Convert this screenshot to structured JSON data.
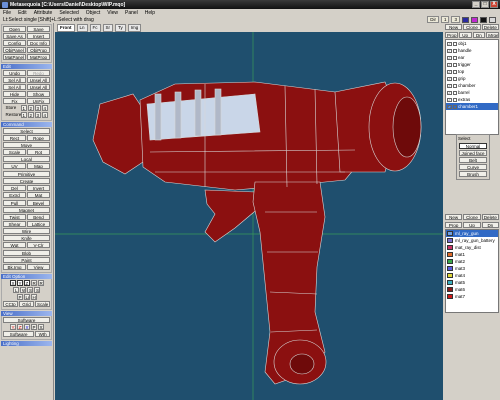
{
  "window": {
    "title": "Metasequoia [C:\\Users\\Daniel\\Desktop\\WIP.mqo]",
    "min": "_",
    "max": "□",
    "close": "X"
  },
  "menu": [
    "File",
    "Edit",
    "Attribute",
    "Selected",
    "Object",
    "View",
    "Panel",
    "Help"
  ],
  "status": {
    "text": "Lt:Select single  [Shift]+L:Select with drag",
    "right_buttons": [
      "Dir",
      "1",
      "3"
    ],
    "palette_colors": [
      "#2a2aa0",
      "#c02ad0",
      "#111111",
      "#d8d8d8"
    ]
  },
  "left_panel": {
    "file": {
      "rows": [
        [
          "Open",
          "Save"
        ],
        [
          "Save As",
          "Insert"
        ],
        [
          "Config",
          "Doc Info"
        ],
        [
          "ObjPanel",
          "ObjProp"
        ],
        [
          "MatPanel",
          "MatProp"
        ]
      ]
    },
    "edit": {
      "title": "Edit",
      "rows": [
        [
          "Undo",
          "Redo"
        ],
        [
          "Sel All",
          "Unsel All"
        ],
        [
          "Sel All",
          "Unsel All"
        ],
        [
          "Hide",
          "Show"
        ],
        [
          "Fix",
          "UnFix"
        ]
      ],
      "store": "Store",
      "restore": "Restore",
      "slots": [
        "1",
        "2",
        "3",
        "4"
      ]
    },
    "command": {
      "title": "Command",
      "items": [
        [
          "Select"
        ],
        [
          "Rect",
          "Rope"
        ],
        [
          "Move"
        ],
        [
          "Scale",
          "Rot"
        ],
        [
          "Local"
        ],
        [
          "UV",
          "Map"
        ],
        [
          "Primitive"
        ],
        [
          "Create"
        ],
        [
          "Del",
          "Invert"
        ],
        [
          "Extrd",
          "Mat"
        ],
        [
          "Pull",
          "Bevel"
        ],
        [
          "Magnet"
        ],
        [
          "Twist",
          "Bend"
        ],
        [
          "Shear",
          "Lattice"
        ],
        [
          "Wire"
        ],
        [
          "Knife"
        ],
        [
          "Wgt",
          "V-Clr"
        ],
        [
          "Blob"
        ],
        [
          "Paint"
        ],
        [
          "Bk.Img",
          "View"
        ]
      ]
    },
    "edit_option": {
      "title": "Edit Option",
      "row1": [
        "X",
        "Y",
        "Z",
        "Rc",
        "Rp"
      ],
      "row2": [
        "L",
        "W",
        "S",
        "Sy"
      ],
      "row3": [
        "P",
        "Ln",
        "Hi"
      ],
      "row4": [
        "CCtp",
        "Grid",
        "Scale"
      ]
    },
    "view": {
      "title": "View",
      "software": "Software",
      "axis": [
        "YZ",
        "ZX",
        "XY",
        "P",
        "Xz"
      ],
      "bottom": [
        "Software",
        "Wth"
      ]
    },
    "lighting": {
      "title": "Lighting"
    }
  },
  "viewport": {
    "tabs": [
      "Front",
      "Ln",
      "Fc",
      "Sr",
      "Ty",
      "Img"
    ],
    "active_tab": "Front",
    "background": "#1f4f6e",
    "model": "ray-gun"
  },
  "right_panel": {
    "object_buttons": [
      "New",
      "Clone",
      "Delete"
    ],
    "object_tabs": [
      "Prop",
      "Up",
      "Dn",
      "Mrge"
    ],
    "objects": [
      {
        "name": "obj1",
        "selected": false
      },
      {
        "name": "handle",
        "selected": false
      },
      {
        "name": "ear",
        "selected": false
      },
      {
        "name": "trigger",
        "selected": false
      },
      {
        "name": "top",
        "selected": false
      },
      {
        "name": "grip",
        "selected": false
      },
      {
        "name": "chamber",
        "selected": false
      },
      {
        "name": "barrel",
        "selected": false
      },
      {
        "name": "extras",
        "selected": false
      },
      {
        "name": "chamber1",
        "selected": true
      }
    ],
    "select_box": {
      "title": "Select",
      "buttons": [
        "Normal",
        "Joined face",
        "Belt",
        "Curve",
        "Brush"
      ]
    },
    "material_buttons": [
      "New",
      "Clone",
      "Delete"
    ],
    "material_tabs": [
      "Prop",
      "Up",
      "Dn"
    ],
    "materials": [
      {
        "name": "ml_ray_gun",
        "color": "#6fa0e0",
        "selected": true
      },
      {
        "name": "ml_ray_gun_battery",
        "color": "#7b6fcf",
        "selected": false
      },
      {
        "name": "mat_ray_dist",
        "color": "#cc3366",
        "selected": false
      },
      {
        "name": "mat1",
        "color": "#e06a28",
        "selected": false
      },
      {
        "name": "mat2",
        "color": "#3aa84a",
        "selected": false
      },
      {
        "name": "mat3",
        "color": "#5b5be0",
        "selected": false
      },
      {
        "name": "mat4",
        "color": "#e0d83a",
        "selected": false
      },
      {
        "name": "mat5",
        "color": "#3ab0c0",
        "selected": false
      },
      {
        "name": "mat6",
        "color": "#8b1a1a",
        "selected": false
      },
      {
        "name": "mat7",
        "color": "#d01a1a",
        "selected": false
      }
    ]
  }
}
